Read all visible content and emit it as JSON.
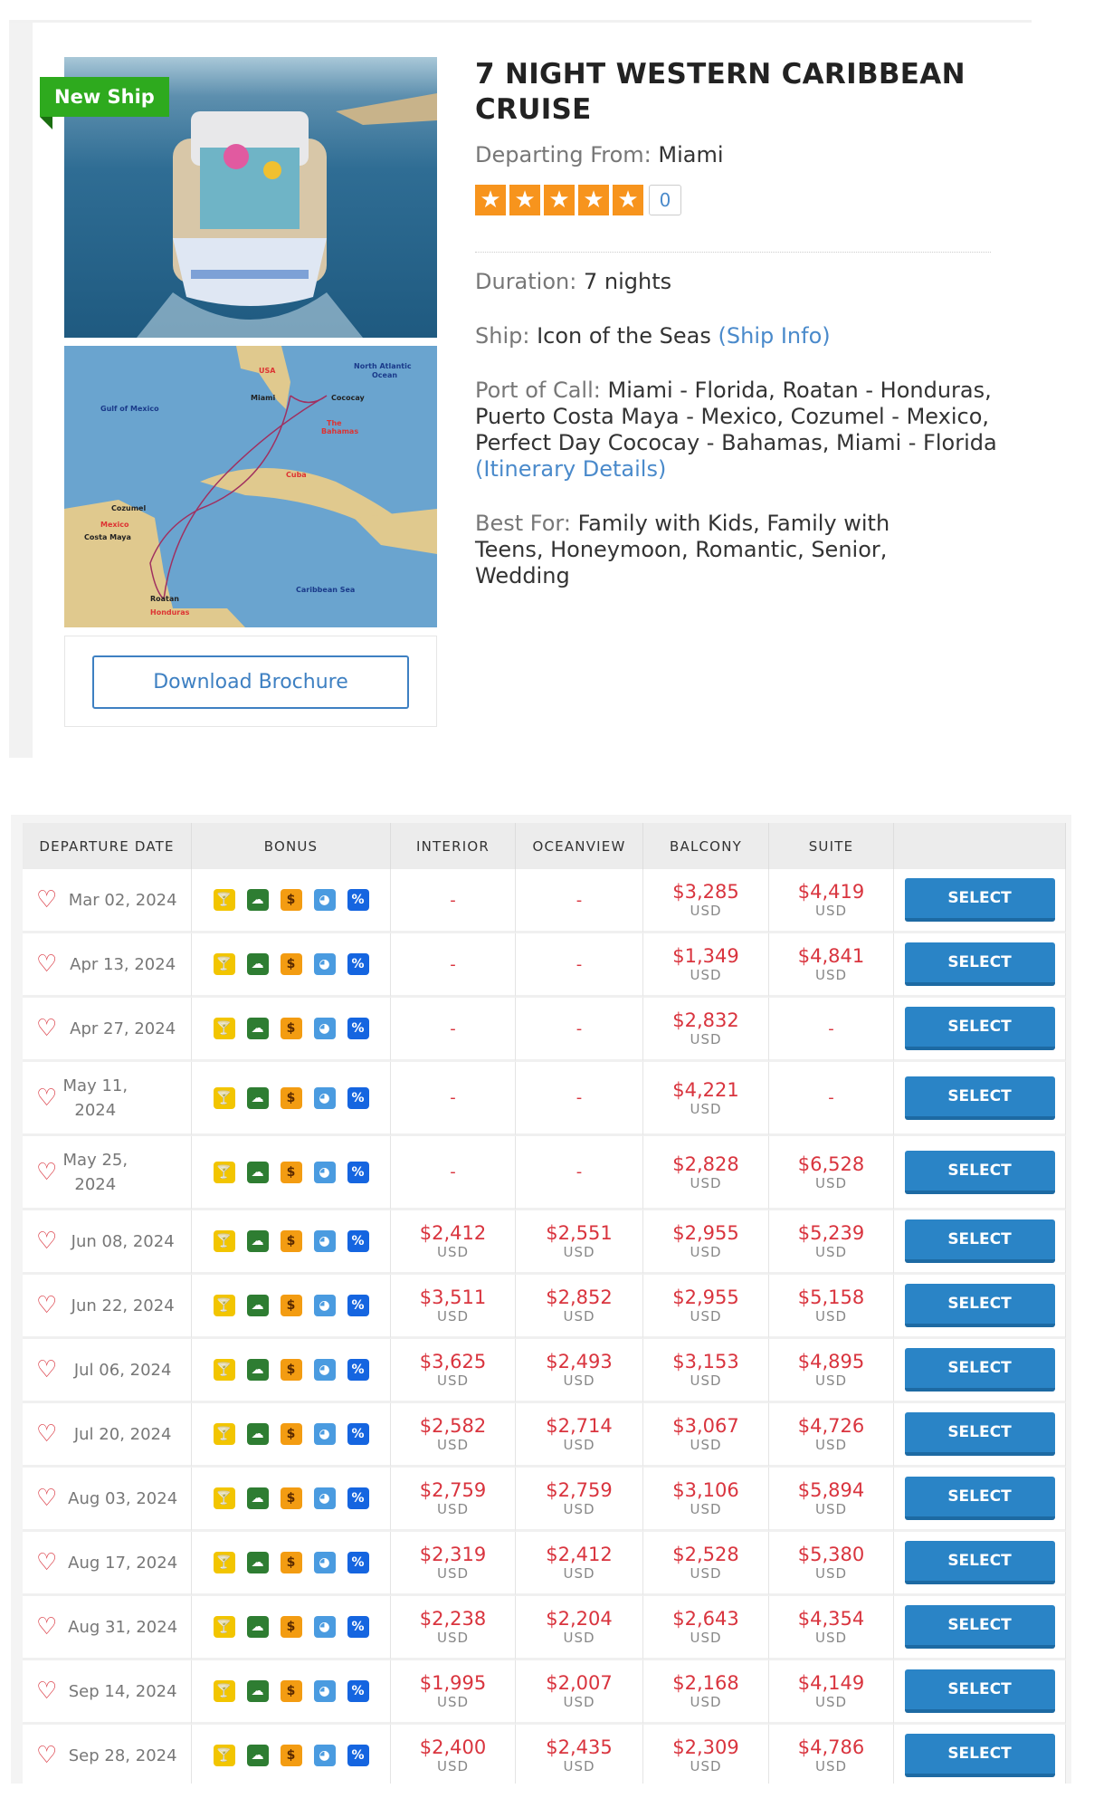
{
  "cruise": {
    "badge": "New Ship",
    "title": "7 NIGHT WESTERN CARIBBEAN CRUISE",
    "departing_label": "Departing From:",
    "departing_value": "Miami",
    "rating_stars": 5,
    "rating_count": "0",
    "duration_label": "Duration:",
    "duration_value": "7 nights",
    "ship_label": "Ship:",
    "ship_value": "Icon of the Seas",
    "ship_link": "(Ship Info)",
    "port_label": "Port of Call:",
    "port_value": "Miami - Florida, Roatan - Honduras, Puerto Costa Maya - Mexico, Cozumel - Mexico, Perfect Day Cococay - Bahamas, Miami - Florida",
    "port_link": "(Itinerary Details)",
    "best_label": "Best For:",
    "best_value": "Family with Kids, Family with Teens, Honeymoon, Romantic, Senior, Wedding",
    "brochure_button": "Download Brochure",
    "map_labels": {
      "usa": "USA",
      "atlantic": "North Atlantic Ocean",
      "gulf": "Gulf of Mexico",
      "miami": "Miami",
      "cococay": "Cococay",
      "bahamas": "The Bahamas",
      "cuba": "Cuba",
      "cozumel": "Cozumel",
      "mexico": "Mexico",
      "costa_maya": "Costa Maya",
      "caribbean": "Caribbean Sea",
      "roatan": "Roatan",
      "honduras": "Honduras"
    }
  },
  "table": {
    "headers": [
      "DEPARTURE DATE",
      "BONUS",
      "INTERIOR",
      "OCEANVIEW",
      "BALCONY",
      "SUITE",
      ""
    ],
    "currency": "USD",
    "select_label": "SELECT",
    "bonus_icons": [
      {
        "name": "drink-package-icon",
        "glyph": "🍸",
        "color": "#f2c500"
      },
      {
        "name": "wifi-cloud-icon",
        "glyph": "☁",
        "color": "#2e7d32"
      },
      {
        "name": "onboard-credit-icon",
        "glyph": "$",
        "color": "#f39c12"
      },
      {
        "name": "beach-ball-icon",
        "glyph": "◕",
        "color": "#4a9be0"
      },
      {
        "name": "discount-icon",
        "glyph": "%",
        "color": "#1565e0"
      }
    ],
    "rows": [
      {
        "date": "Mar 02, 2024",
        "interior": "-",
        "oceanview": "-",
        "balcony": "$3,285",
        "suite": "$4,419"
      },
      {
        "date": "Apr 13, 2024",
        "interior": "-",
        "oceanview": "-",
        "balcony": "$1,349",
        "suite": "$4,841"
      },
      {
        "date": "Apr 27, 2024",
        "interior": "-",
        "oceanview": "-",
        "balcony": "$2,832",
        "suite": "-"
      },
      {
        "date": "May 11, 2024",
        "interior": "-",
        "oceanview": "-",
        "balcony": "$4,221",
        "suite": "-",
        "wrap": true
      },
      {
        "date": "May 25, 2024",
        "interior": "-",
        "oceanview": "-",
        "balcony": "$2,828",
        "suite": "$6,528",
        "wrap": true
      },
      {
        "date": "Jun 08, 2024",
        "interior": "$2,412",
        "oceanview": "$2,551",
        "balcony": "$2,955",
        "suite": "$5,239"
      },
      {
        "date": "Jun 22, 2024",
        "interior": "$3,511",
        "oceanview": "$2,852",
        "balcony": "$2,955",
        "suite": "$5,158"
      },
      {
        "date": "Jul 06, 2024",
        "interior": "$3,625",
        "oceanview": "$2,493",
        "balcony": "$3,153",
        "suite": "$4,895"
      },
      {
        "date": "Jul 20, 2024",
        "interior": "$2,582",
        "oceanview": "$2,714",
        "balcony": "$3,067",
        "suite": "$4,726"
      },
      {
        "date": "Aug 03, 2024",
        "interior": "$2,759",
        "oceanview": "$2,759",
        "balcony": "$3,106",
        "suite": "$5,894"
      },
      {
        "date": "Aug 17, 2024",
        "interior": "$2,319",
        "oceanview": "$2,412",
        "balcony": "$2,528",
        "suite": "$5,380"
      },
      {
        "date": "Aug 31, 2024",
        "interior": "$2,238",
        "oceanview": "$2,204",
        "balcony": "$2,643",
        "suite": "$4,354"
      },
      {
        "date": "Sep 14, 2024",
        "interior": "$1,995",
        "oceanview": "$2,007",
        "balcony": "$2,168",
        "suite": "$4,149"
      },
      {
        "date": "Sep 28, 2024",
        "interior": "$2,400",
        "oceanview": "$2,435",
        "balcony": "$2,309",
        "suite": "$4,786"
      }
    ]
  }
}
